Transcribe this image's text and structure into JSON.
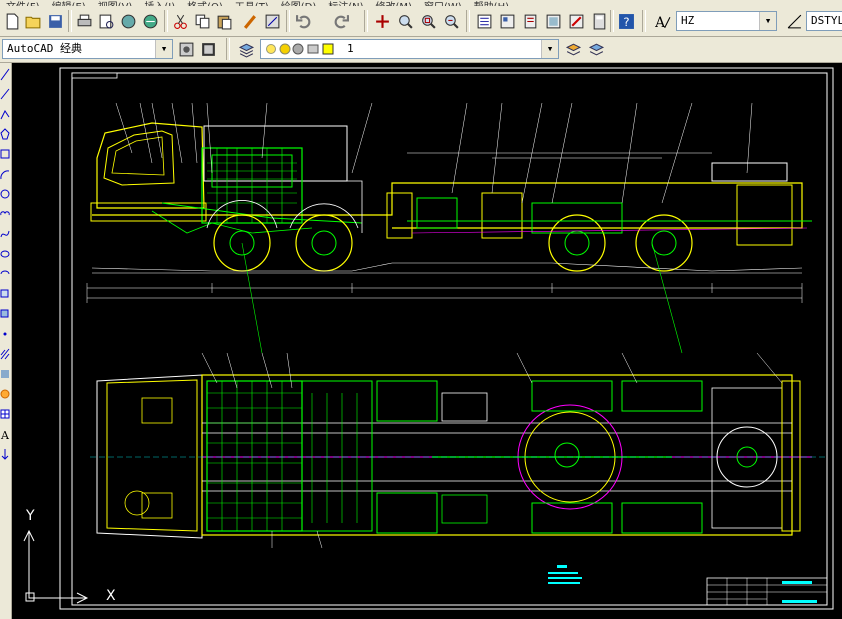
{
  "menubar": {
    "items": [
      "文件(F)",
      "编辑(E)",
      "视图(V)",
      "插入(I)",
      "格式(O)",
      "工具(T)",
      "绘图(D)",
      "标注(N)",
      "修改(M)",
      "窗口(W)",
      "帮助(H)"
    ]
  },
  "toolbar": {
    "text_style_value": "HZ",
    "dim_style_value": "DSTYL",
    "workspace_value": "AutoCAD 经典",
    "layer_value": "1"
  },
  "ucs": {
    "y_label": "Y",
    "x_label": "X"
  },
  "colors": {
    "background": "#000000",
    "border_white": "#ffffff",
    "yellow": "#ffff00",
    "green": "#00ff00",
    "magenta": "#ff00ff",
    "cyan": "#00ffff"
  }
}
